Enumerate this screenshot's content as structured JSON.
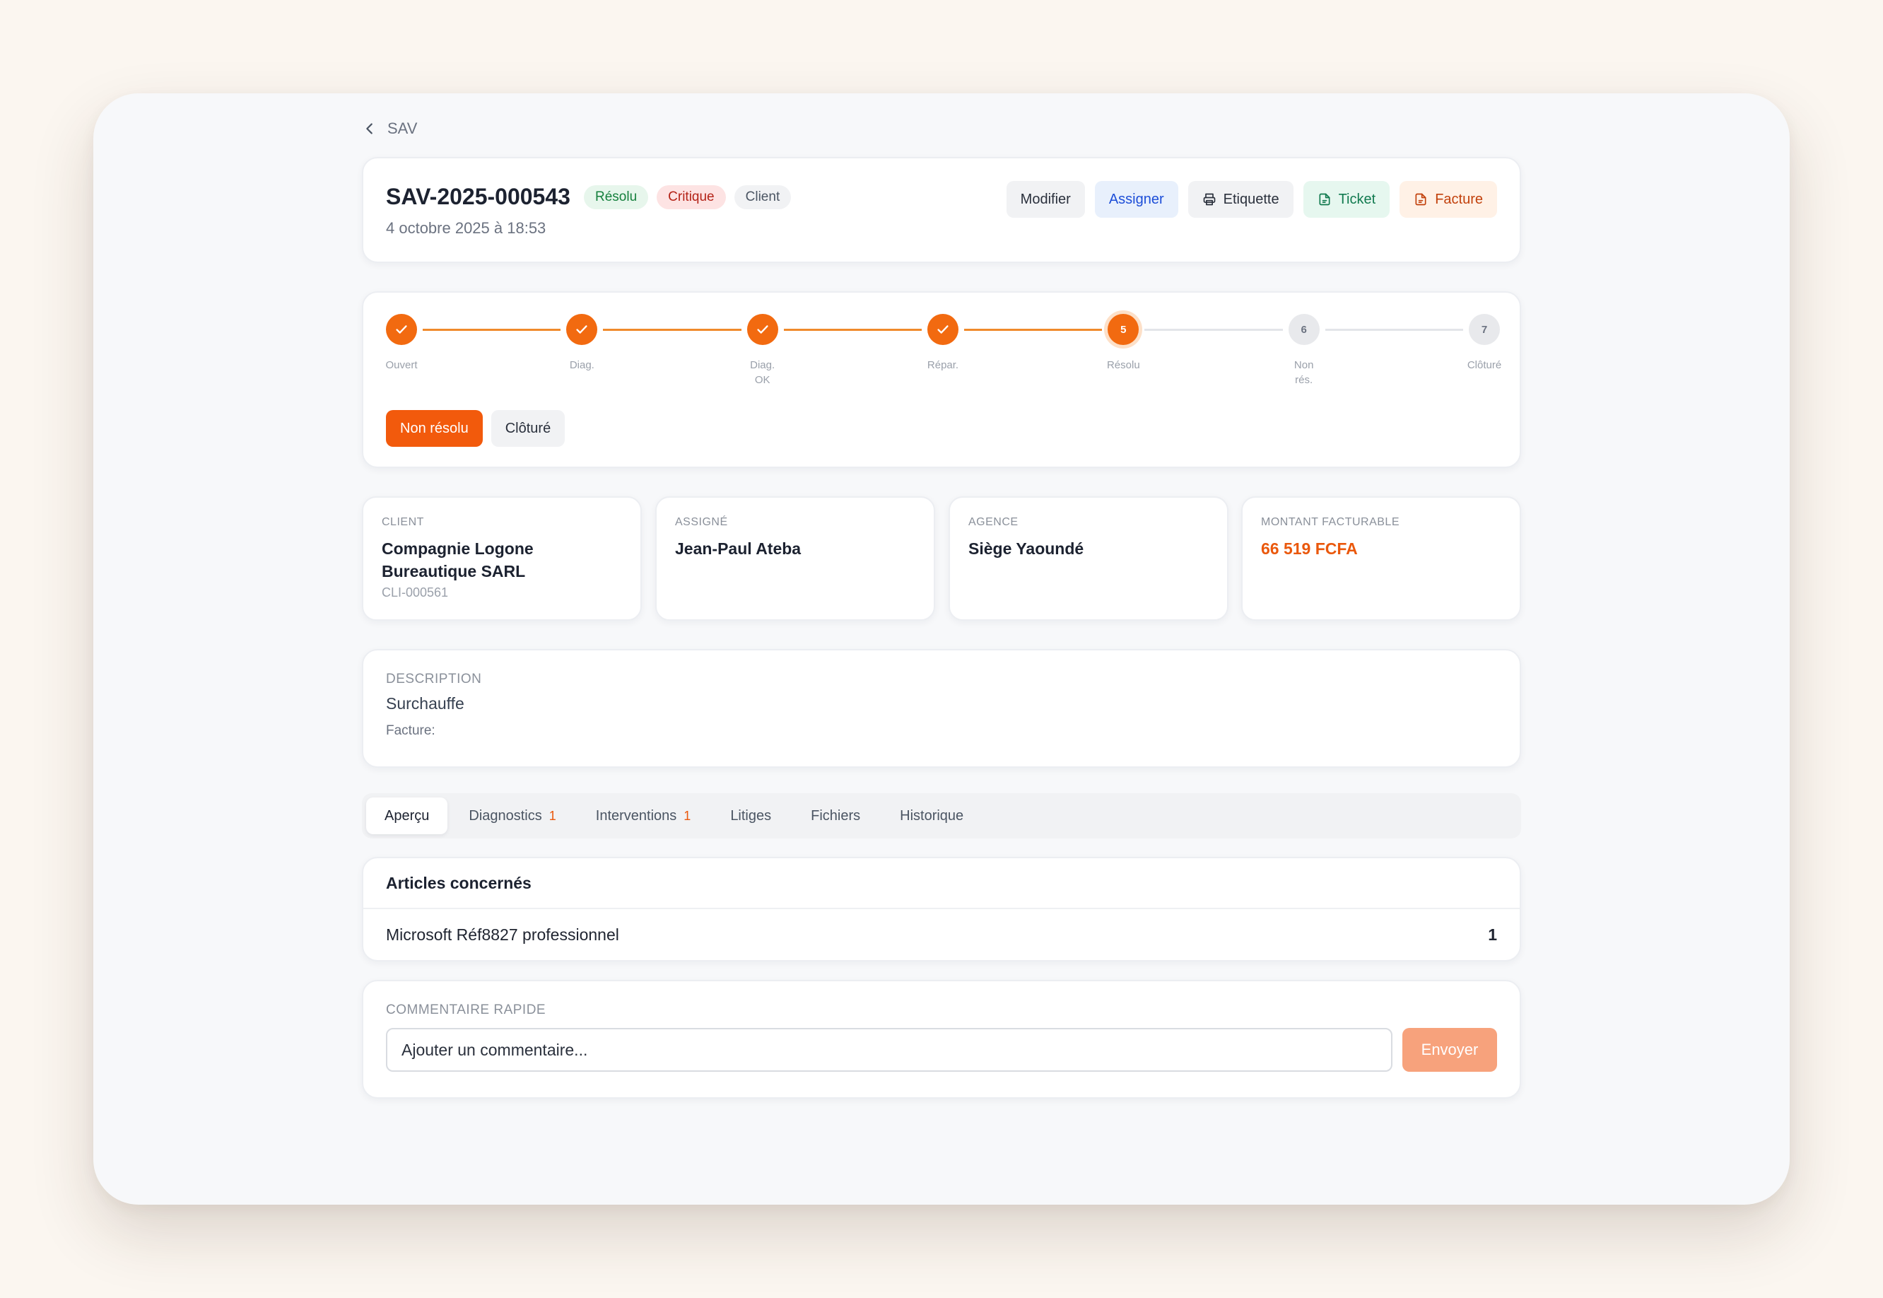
{
  "nav": {
    "back_label": "SAV"
  },
  "ticket": {
    "id": "SAV-2025-000543",
    "badges": {
      "status": "Résolu",
      "priority": "Critique",
      "type": "Client"
    },
    "date": "4 octobre 2025 à 18:53"
  },
  "actions": {
    "modifier": "Modifier",
    "assigner": "Assigner",
    "etiquette": "Etiquette",
    "ticket": "Ticket",
    "facture": "Facture"
  },
  "progress": {
    "current_step": 5,
    "steps": [
      {
        "num": "1",
        "label": "Ouvert"
      },
      {
        "num": "2",
        "label": "Diag."
      },
      {
        "num": "3",
        "label": "Diag.\nOK"
      },
      {
        "num": "4",
        "label": "Répar."
      },
      {
        "num": "5",
        "label": "Résolu"
      },
      {
        "num": "6",
        "label": "Non\nrés."
      },
      {
        "num": "7",
        "label": "Clôturé"
      }
    ],
    "buttons": {
      "unresolved": "Non résolu",
      "close": "Clôturé"
    }
  },
  "info": {
    "client": {
      "label": "CLIENT",
      "value": "Compagnie Logone Bureautique SARL",
      "code": "CLI-000561"
    },
    "assignee": {
      "label": "ASSIGNÉ",
      "value": "Jean-Paul Ateba"
    },
    "agency": {
      "label": "AGENCE",
      "value": "Siège Yaoundé"
    },
    "amount": {
      "label": "MONTANT FACTURABLE",
      "value": "66 519 FCFA"
    }
  },
  "description": {
    "label": "DESCRIPTION",
    "text": "Surchauffe",
    "invoice_label": "Facture:"
  },
  "tabs": [
    {
      "label": "Aperçu",
      "count": ""
    },
    {
      "label": "Diagnostics",
      "count": "1"
    },
    {
      "label": "Interventions",
      "count": "1"
    },
    {
      "label": "Litiges",
      "count": ""
    },
    {
      "label": "Fichiers",
      "count": ""
    },
    {
      "label": "Historique",
      "count": ""
    }
  ],
  "articles": {
    "title": "Articles concernés",
    "items": [
      {
        "name": "Microsoft Réf8827 professionnel",
        "qty": "1"
      }
    ]
  },
  "comment": {
    "label": "COMMENTAIRE RAPIDE",
    "placeholder": "Ajouter un commentaire...",
    "send_label": "Envoyer"
  },
  "colors": {
    "accent": "#f26a10",
    "success": "#15803d",
    "danger": "#b42318",
    "info": "#1d4ed8"
  }
}
